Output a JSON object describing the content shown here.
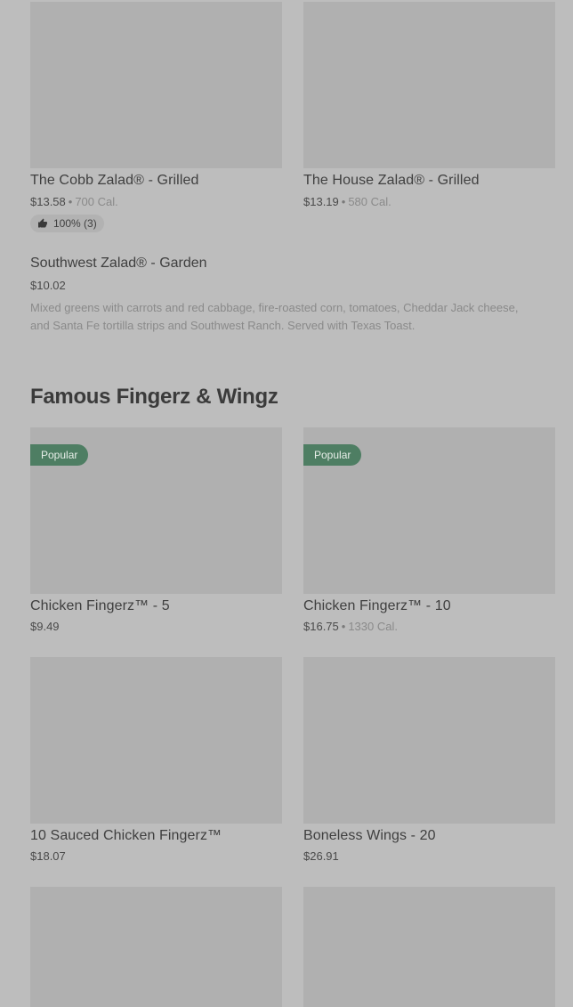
{
  "salads": {
    "cobb": {
      "name": "The Cobb Zalad® - Grilled",
      "price": "$13.58",
      "cal": "700 Cal.",
      "rating": "100% (3)"
    },
    "house": {
      "name": "The House Zalad® - Grilled",
      "price": "$13.19",
      "cal": "580 Cal."
    },
    "southwest": {
      "name": "Southwest Zalad® - Garden",
      "price": "$10.02",
      "description": "Mixed greens with carrots and red cabbage, fire-roasted corn, tomatoes, Cheddar Jack cheese, and Santa Fe tortilla strips and Southwest Ranch. Served with Texas Toast."
    }
  },
  "section": {
    "title": "Famous Fingerz & Wingz"
  },
  "fingerz": {
    "badge": "Popular",
    "item1": {
      "name": "Chicken Fingerz™ - 5",
      "price": "$9.49"
    },
    "item2": {
      "name": "Chicken Fingerz™ - 10",
      "price": "$16.75",
      "cal": "1330 Cal."
    },
    "item3": {
      "name": "10 Sauced Chicken Fingerz™",
      "price": "$18.07"
    },
    "item4": {
      "name": "Boneless Wings - 20",
      "price": "$26.91"
    }
  },
  "meta": {
    "separator": "•"
  },
  "icons": {
    "rating": "thumbs-up-icon"
  }
}
